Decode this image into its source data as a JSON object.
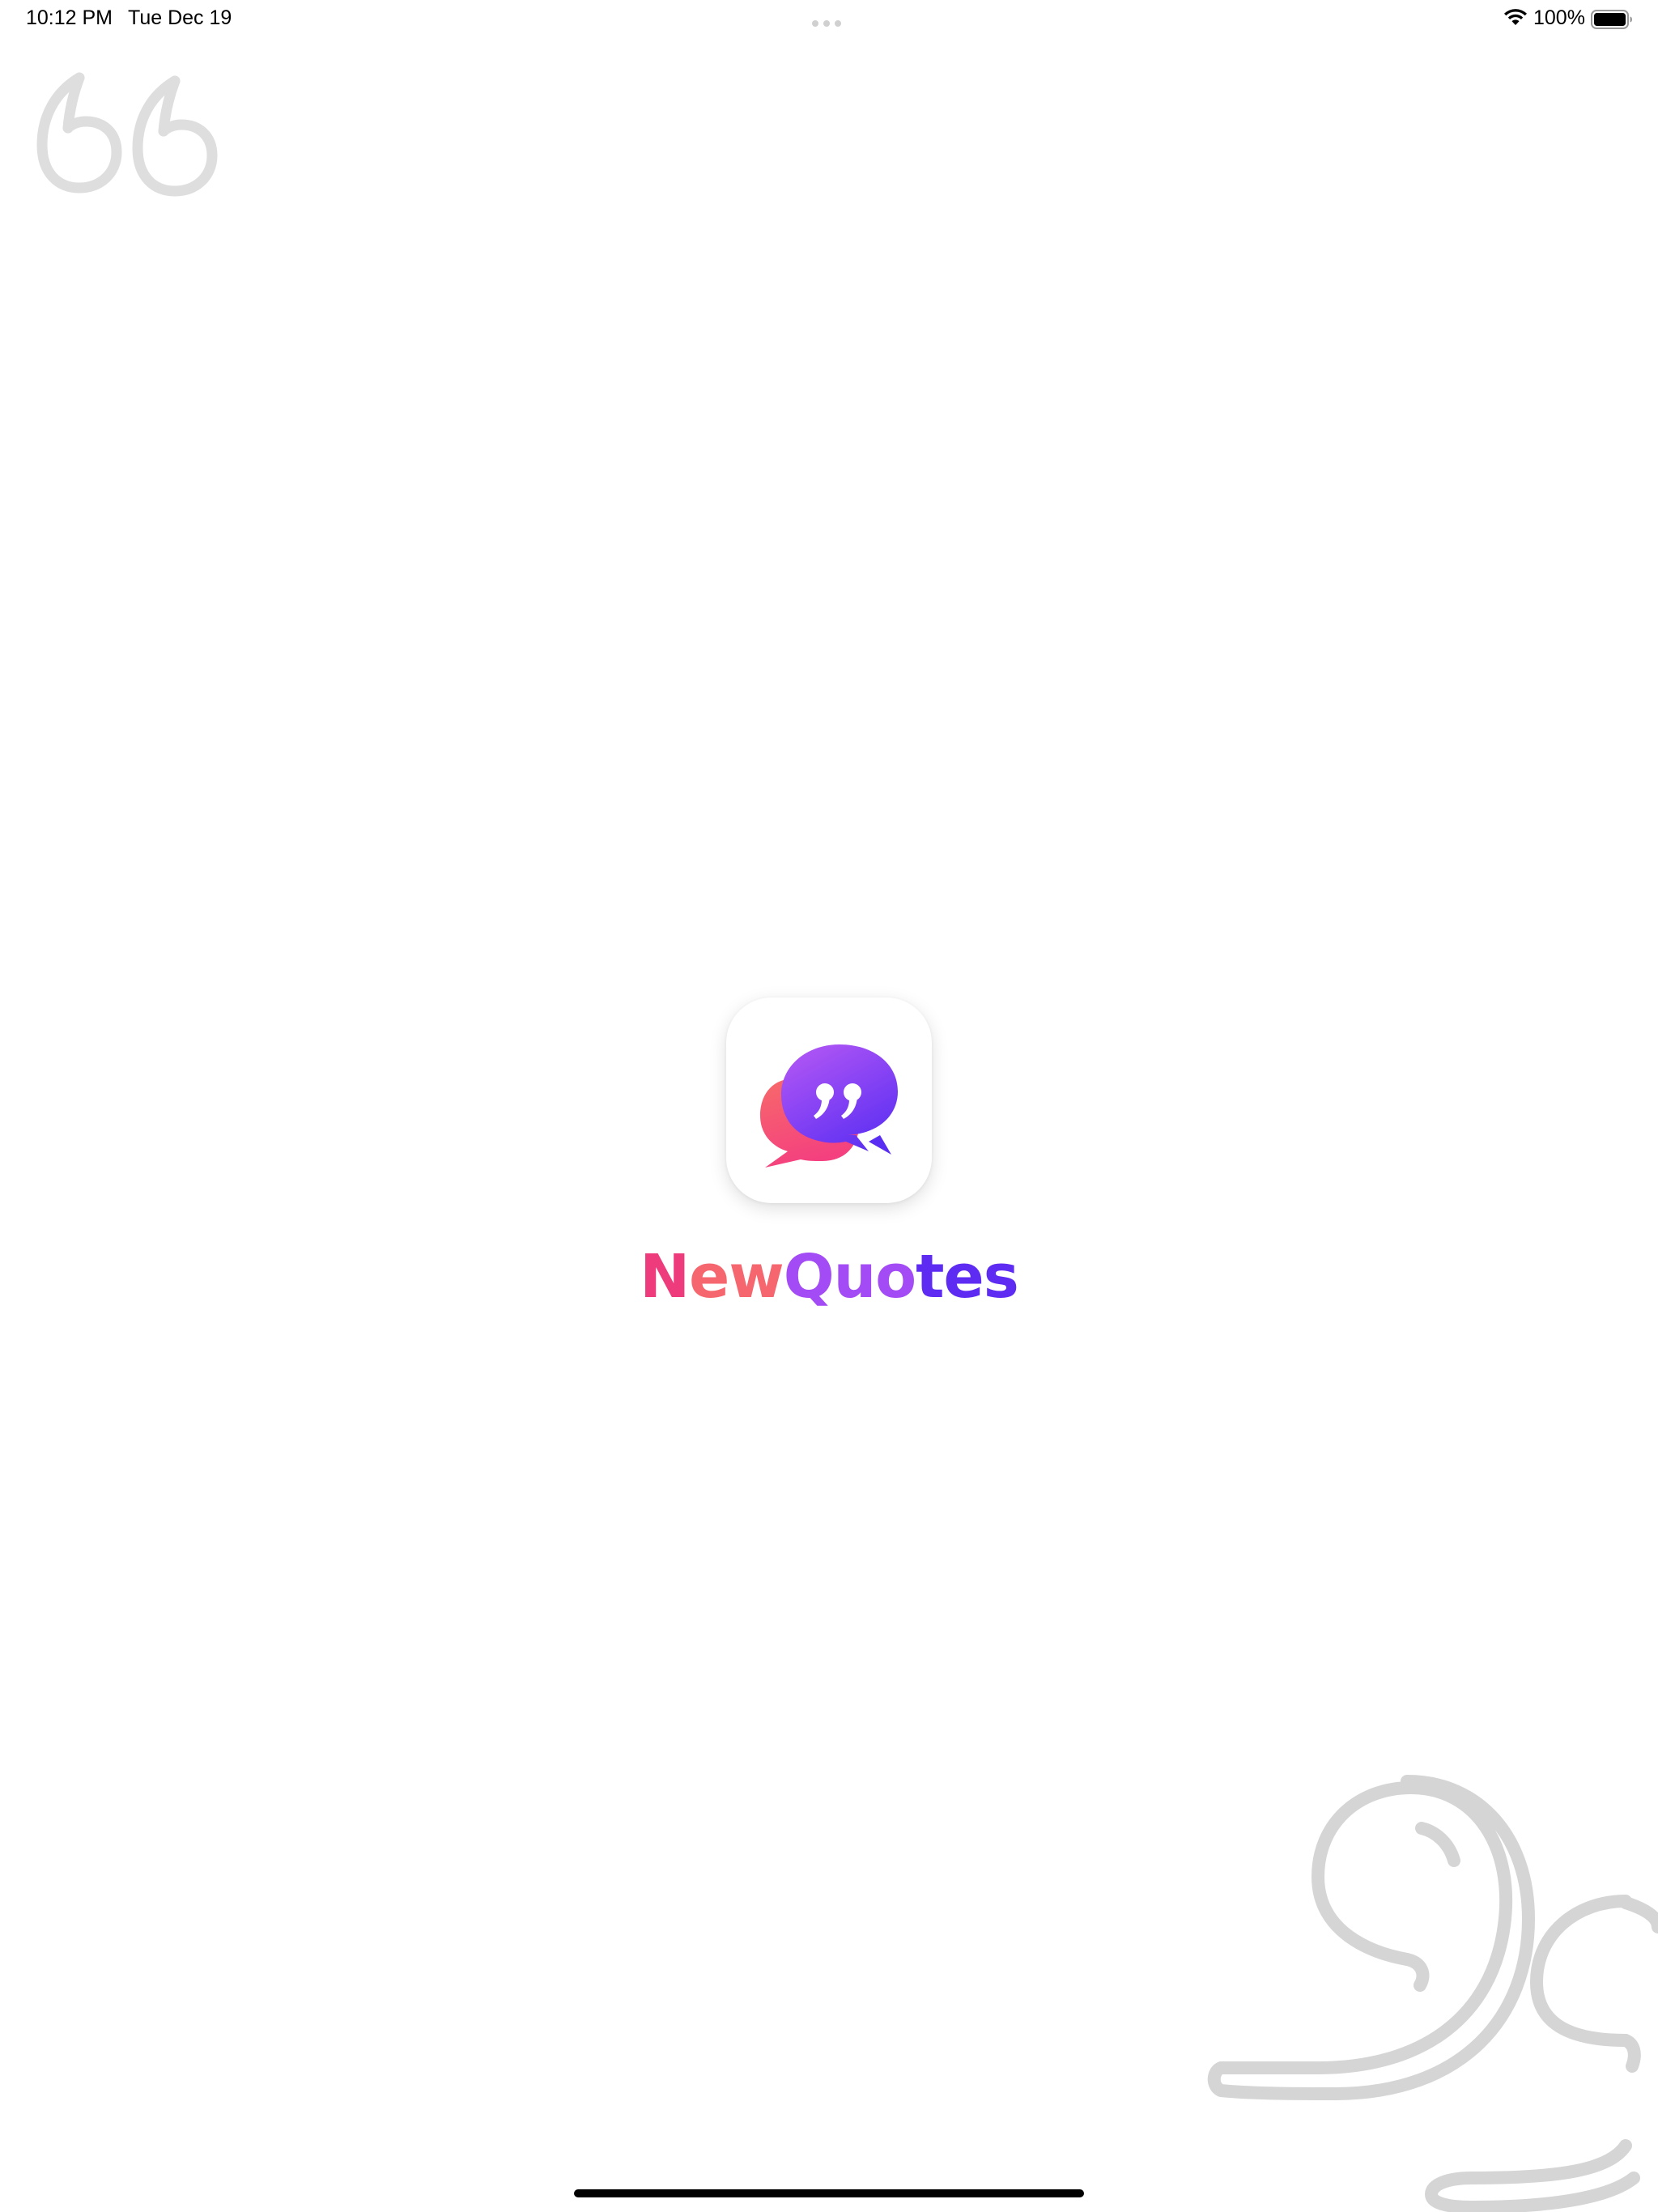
{
  "status_bar": {
    "time": "10:12 PM",
    "date": "Tue Dec 19",
    "battery_percent": "100%",
    "wifi_icon": "wifi-icon",
    "battery_icon": "battery-full-icon",
    "battery_level": 1.0
  },
  "splash": {
    "app_name": {
      "part1": "N",
      "part2": "ew",
      "part3": "Quo",
      "part4": "tes"
    },
    "app_icon": "speech-bubbles-quote-icon",
    "decorative_top_icon": "open-quote-icon",
    "decorative_bottom_icon": "close-quote-icon"
  },
  "colors": {
    "brand_pink": "#ee3b7c",
    "brand_coral": "#f5666e",
    "brand_purple": "#a34bf4",
    "brand_indigo": "#5e2bf2",
    "decoration_gray": "#d6d6d6",
    "background": "#ffffff"
  }
}
